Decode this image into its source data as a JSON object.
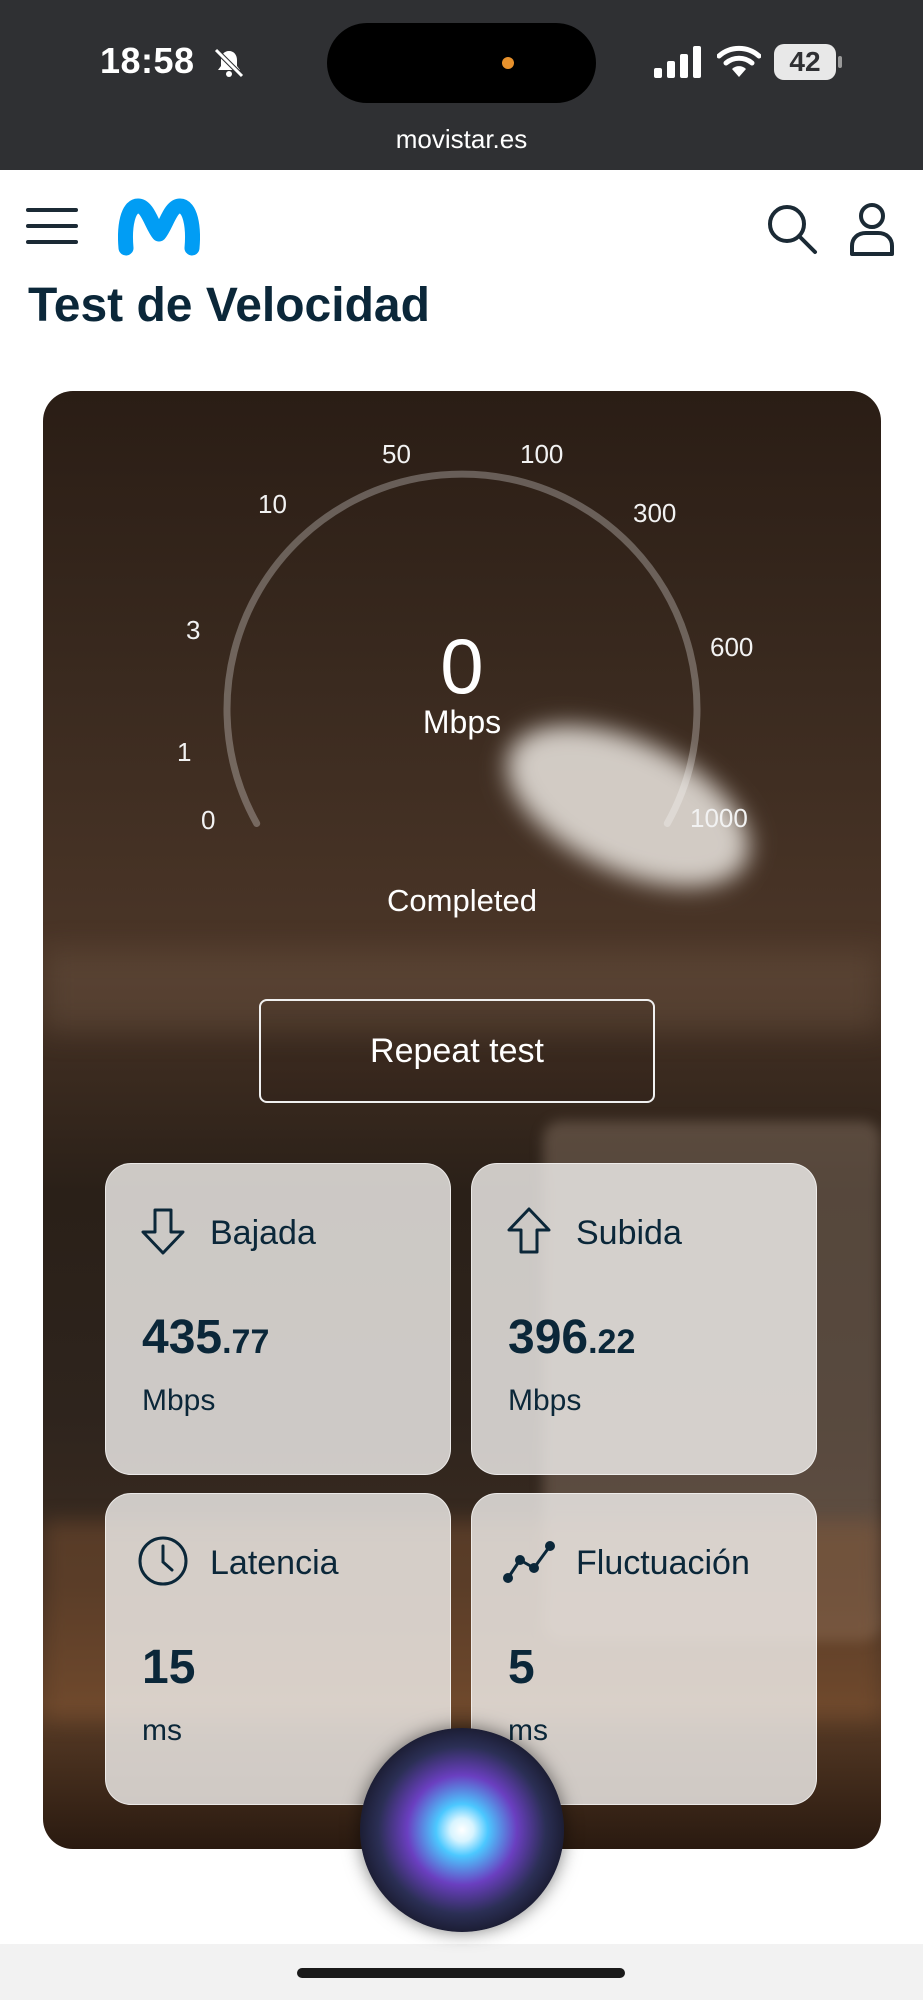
{
  "status_bar": {
    "time": "18:58",
    "battery": "42",
    "url": "movistar.es"
  },
  "header": {
    "brand": "movistar",
    "title": "Test de Velocidad"
  },
  "gauge": {
    "scale_labels": [
      "0",
      "1",
      "3",
      "10",
      "50",
      "100",
      "300",
      "600",
      "1000"
    ],
    "value": "0",
    "unit": "Mbps",
    "status": "Completed"
  },
  "repeat_button": "Repeat test",
  "metrics": {
    "download": {
      "label": "Bajada",
      "value_int": "435",
      "value_dec": ".77",
      "unit": "Mbps",
      "icon": "arrow-down-icon"
    },
    "upload": {
      "label": "Subida",
      "value_int": "396",
      "value_dec": ".22",
      "unit": "Mbps",
      "icon": "arrow-up-icon"
    },
    "latency": {
      "label": "Latencia",
      "value_int": "15",
      "value_dec": "",
      "unit": "ms",
      "icon": "clock-icon"
    },
    "jitter": {
      "label": "Fluctuación",
      "value_int": "5",
      "value_dec": "",
      "unit": "ms",
      "icon": "jitter-icon"
    }
  },
  "colors": {
    "brand_blue": "#019df4",
    "text_dark": "#0b2739",
    "status_bar_bg": "#2f3033"
  }
}
